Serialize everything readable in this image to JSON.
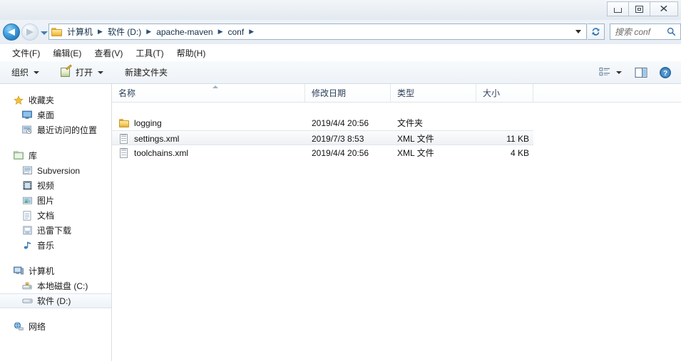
{
  "window": {
    "controls": {
      "minimize_label": "Minimize",
      "maximize_label": "Maximize",
      "close_label": "Close",
      "close_glyph": "✕"
    }
  },
  "addressbar": {
    "back_label": "◀",
    "forward_label": "▶",
    "breadcrumbs": [
      "计算机",
      "软件 (D:)",
      "apache-maven",
      "conf"
    ],
    "separator": "▶",
    "refresh_label": "Refresh"
  },
  "search": {
    "placeholder": "搜索 conf"
  },
  "menubar": {
    "items": [
      "文件(F)",
      "编辑(E)",
      "查看(V)",
      "工具(T)",
      "帮助(H)"
    ]
  },
  "toolbar": {
    "organize_label": "组织",
    "open_label": "打开",
    "new_folder_label": "新建文件夹",
    "view_label": "Change view",
    "preview_label": "Show preview pane",
    "help_label": "Help"
  },
  "sidebar": {
    "sections": [
      {
        "header": "收藏夹",
        "header_icon": "star-icon",
        "items": [
          {
            "label": "桌面",
            "icon": "desktop-icon"
          },
          {
            "label": "最近访问的位置",
            "icon": "recent-places-icon"
          }
        ]
      },
      {
        "header": "库",
        "header_icon": "library-icon",
        "items": [
          {
            "label": "Subversion",
            "icon": "subversion-icon"
          },
          {
            "label": "视频",
            "icon": "video-icon"
          },
          {
            "label": "图片",
            "icon": "pictures-icon"
          },
          {
            "label": "文档",
            "icon": "documents-icon"
          },
          {
            "label": "迅雷下载",
            "icon": "downloads-icon"
          },
          {
            "label": "音乐",
            "icon": "music-icon"
          }
        ]
      },
      {
        "header": "计算机",
        "header_icon": "computer-icon",
        "items": [
          {
            "label": "本地磁盘 (C:)",
            "icon": "hdd-system-icon",
            "selected": false
          },
          {
            "label": "软件 (D:)",
            "icon": "hdd-icon",
            "selected": true
          }
        ]
      },
      {
        "header": "网络",
        "header_icon": "network-icon",
        "items": []
      }
    ]
  },
  "filelist": {
    "columns": [
      {
        "label": "名称",
        "sorted": "asc"
      },
      {
        "label": "修改日期"
      },
      {
        "label": "类型"
      },
      {
        "label": "大小"
      }
    ],
    "rows": [
      {
        "name": "logging",
        "icon": "folder-icon",
        "date": "2019/4/4 20:56",
        "type": "文件夹",
        "size": "",
        "hover": false
      },
      {
        "name": "settings.xml",
        "icon": "xml-file-icon",
        "date": "2019/7/3 8:53",
        "type": "XML 文件",
        "size": "11 KB",
        "hover": true
      },
      {
        "name": "toolchains.xml",
        "icon": "xml-file-icon",
        "date": "2019/4/4 20:56",
        "type": "XML 文件",
        "size": "4 KB",
        "hover": false
      }
    ]
  }
}
